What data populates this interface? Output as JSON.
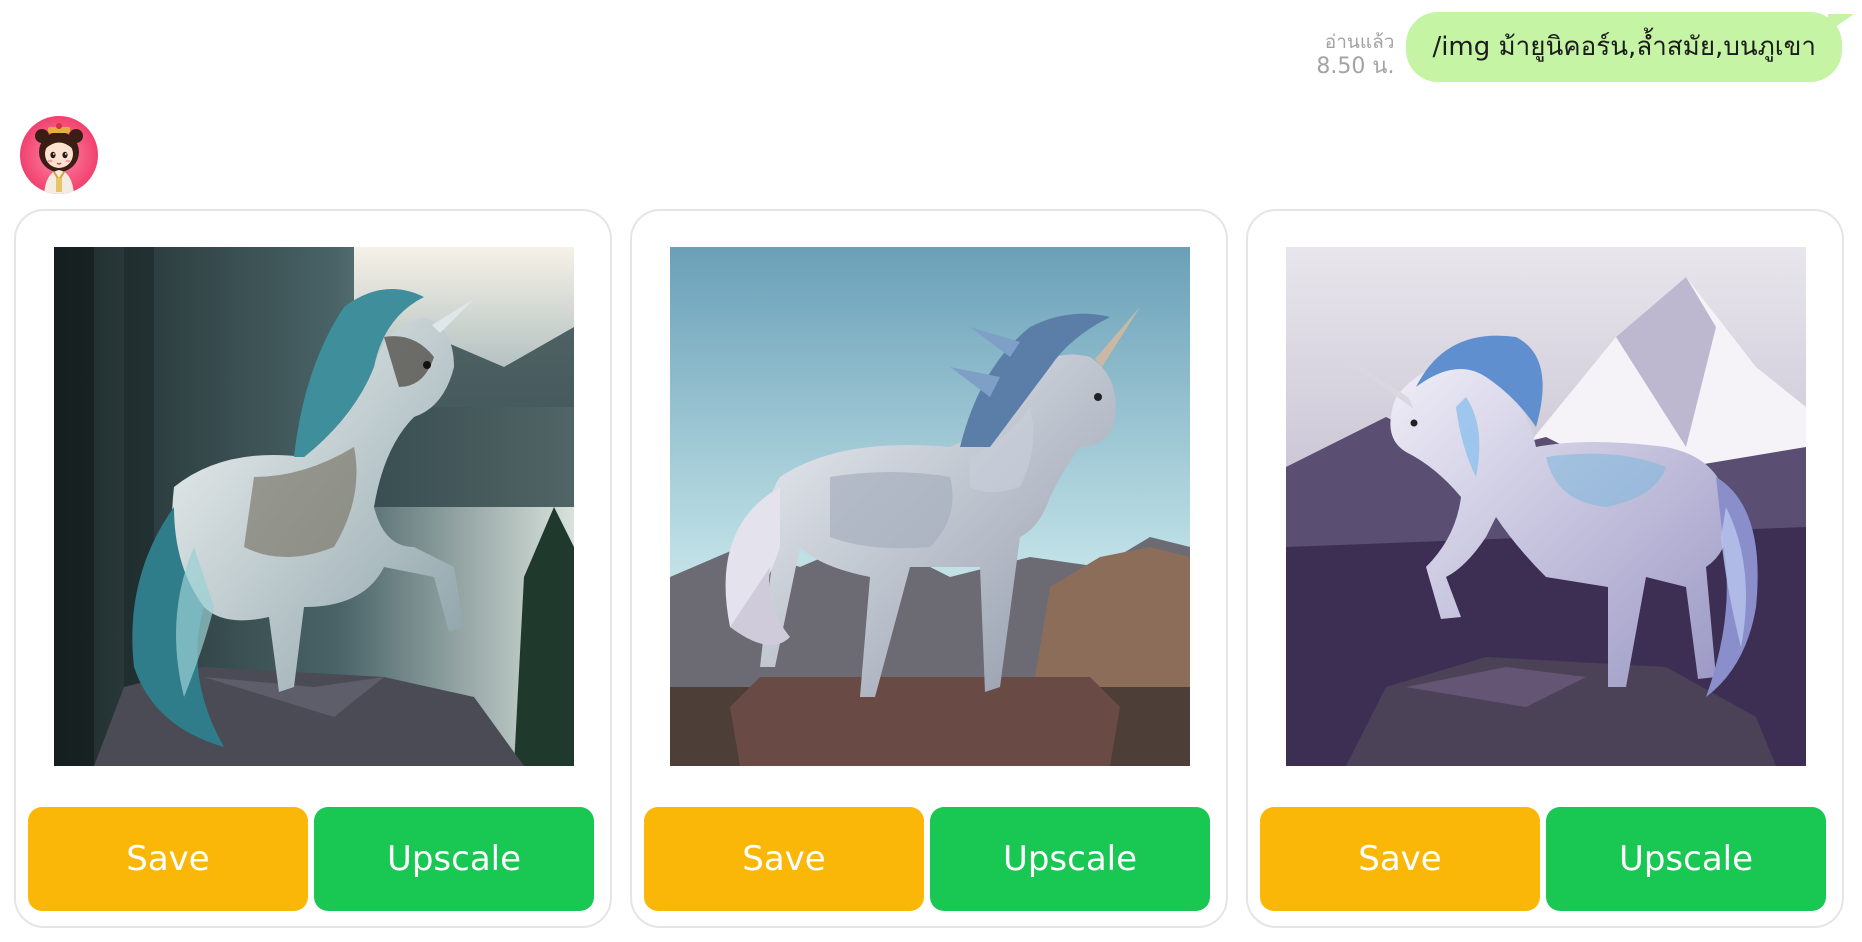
{
  "outgoing": {
    "read_status": "อ่านแล้ว",
    "time": "8.50 น.",
    "text": "/img ม้ายูนิคอร์น,ล้ำสมัย,บนภูเขา",
    "bubble_color": "#c4f4a4"
  },
  "bot": {
    "avatar_icon": "avatar-girl-icon"
  },
  "cards": [
    {
      "image": "unicorn-forest-image",
      "save_label": "Save",
      "upscale_label": "Upscale"
    },
    {
      "image": "unicorn-sky-image",
      "save_label": "Save",
      "upscale_label": "Upscale"
    },
    {
      "image": "unicorn-mountain-image",
      "save_label": "Save",
      "upscale_label": "Upscale"
    }
  ],
  "colors": {
    "save": "#fbb707",
    "upscale": "#18c852",
    "card_border": "#e5e5e5"
  }
}
